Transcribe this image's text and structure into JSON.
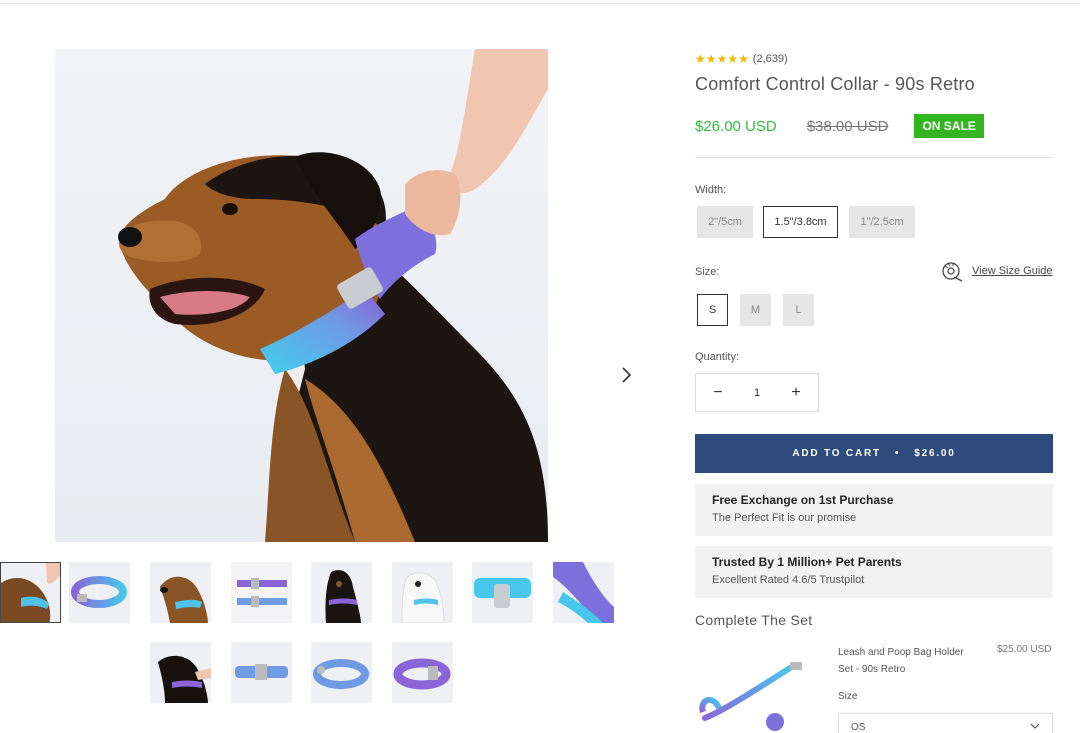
{
  "product": {
    "rating_stars": "★★★★★",
    "rating_count": "(2,639)",
    "title": "Comfort Control Collar - 90s Retro",
    "price": "$26.00 USD",
    "compare_price": "$38.00 USD",
    "sale_badge": "ON SALE"
  },
  "width": {
    "label": "Width:",
    "options": [
      "2\"/5cm",
      "1.5\"/3.8cm",
      "1\"/2.5cm"
    ],
    "selected": "1.5\"/3.8cm"
  },
  "size": {
    "label": "Size:",
    "options": [
      "S",
      "M",
      "L"
    ],
    "selected": "S",
    "guide_link": "View Size Guide"
  },
  "quantity": {
    "label": "Quantity:",
    "minus": "−",
    "value": "1",
    "plus": "+"
  },
  "cart": {
    "label": "ADD TO CART",
    "separator": "•",
    "price": "$26.00"
  },
  "info_boxes": [
    {
      "title": "Free Exchange on 1st Purchase",
      "subtitle": "The Perfect Fit is our promise"
    },
    {
      "title": "Trusted By 1 Million+ Pet Parents",
      "subtitle": "Excellent Rated 4.6/5 Trustpilot"
    }
  ],
  "complete_set": {
    "heading": "Complete The Set",
    "item_name": "Leash and Poop Bag Holder Set - 90s Retro",
    "item_price": "$25.00 USD",
    "size_label": "Size",
    "size_value": "OS"
  },
  "colors": {
    "accent_green": "#2fbf3a",
    "sale_green": "#33b521",
    "cart_blue": "#2f4b7c",
    "star_gold": "#f5b800",
    "collar_gradient_start": "#48c7ec",
    "collar_gradient_end": "#8b65d8"
  }
}
